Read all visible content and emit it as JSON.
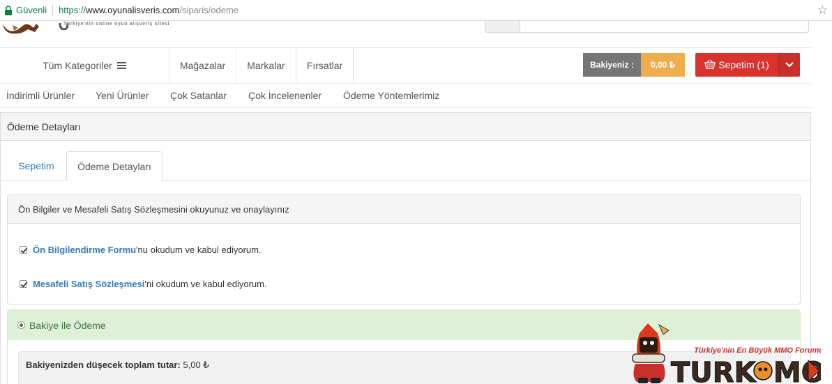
{
  "browser": {
    "secure_label": "Güvenli",
    "url_protocol": "https://",
    "url_host": "www.oyunalisveris.com",
    "url_path": "/siparis/odeme"
  },
  "header": {
    "tagline": "Türkiye'nin online oyun alışveriş sitesi"
  },
  "nav": {
    "categories_label": "Tüm Kategoriler",
    "links": [
      "Mağazalar",
      "Markalar",
      "Fırsatlar"
    ],
    "balance_label": "Bakiyeniz :",
    "balance_value": "0,00 ₺",
    "cart_label": "Sepetim (1)"
  },
  "subnav": {
    "links": [
      "İndirimli Ürünler",
      "Yeni Ürünler",
      "Çok Satanlar",
      "Çok İncelenenler",
      "Ödeme Yöntemlerimiz"
    ]
  },
  "panel": {
    "title": "Ödeme Detayları",
    "tabs": [
      "Sepetim",
      "Ödeme Detayları"
    ],
    "agreement": {
      "title": "Ön Bilgiler ve Mesafeli Satış Sözleşmesini okuyunuz ve onaylayınız",
      "item1_link": "Ön Bilgilendirme Formu",
      "item1_rest": "'nu okudum ve kabul ediyorum.",
      "item2_link": "Mesafeli Satış Sözleşmesi",
      "item2_rest": "'ni okudum ve kabul ediyorum."
    },
    "payment": {
      "title": "Bakiye ile Ödeme",
      "total_label": "Bakiyenizden düşecek toplam tutar:",
      "total_value": "5,00 ₺"
    }
  },
  "watermark": {
    "tagline": "Türkiye'nin En Büyük MMO Forumu",
    "brand_left": "TURK",
    "brand_right": "MO"
  }
}
